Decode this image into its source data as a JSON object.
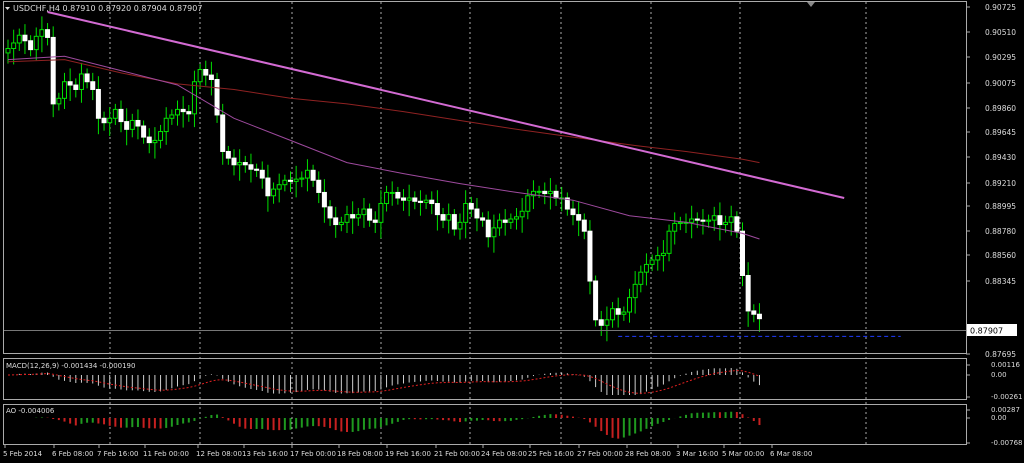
{
  "chart_data": [
    {
      "type": "candlestick",
      "symbol_line": "USDCHF,H4  0.87910 0.87920 0.87904 0.87907",
      "ylim": [
        0.876,
        0.9077
      ],
      "y_ticks": [
        "0.90725",
        "0.90510",
        "0.90295",
        "0.90075",
        "0.89860",
        "0.89645",
        "0.89430",
        "0.89210",
        "0.88995",
        "0.88780",
        "0.88560",
        "0.88345",
        "0.87907",
        "0.87695"
      ],
      "last_price_label": "0.87907",
      "x_ticks": [
        "5 Feb 2014",
        "6 Feb 08:00",
        "7 Feb 16:00",
        "11 Feb 00:00",
        "12 Feb 08:00",
        "13 Feb 16:00",
        "17 Feb 00:00",
        "18 Feb 08:00",
        "19 Feb 16:00",
        "21 Feb 00:00",
        "24 Feb 08:00",
        "25 Feb 16:00",
        "27 Feb 00:00",
        "28 Feb 08:00",
        "3 Mar 16:00",
        "5 Mar 00:00",
        "6 Mar 08:00"
      ],
      "close": [
        0.9035,
        0.904,
        0.9047,
        0.9042,
        0.9034,
        0.9046,
        0.9052,
        0.9045,
        0.8985,
        0.899,
        0.9005,
        0.9002,
        0.8998,
        0.9012,
        0.9005,
        0.8998,
        0.8972,
        0.8968,
        0.8972,
        0.898,
        0.8969,
        0.8962,
        0.897,
        0.8965,
        0.8955,
        0.895,
        0.8952,
        0.896,
        0.8972,
        0.8975,
        0.898,
        0.8978,
        0.8976,
        0.9005,
        0.9016,
        0.9011,
        0.9007,
        0.8975,
        0.8942,
        0.8936,
        0.893,
        0.8932,
        0.893,
        0.8926,
        0.8925,
        0.8918,
        0.8902,
        0.8908,
        0.8912,
        0.8916,
        0.8915,
        0.8917,
        0.8918,
        0.8925,
        0.8916,
        0.8905,
        0.8892,
        0.8882,
        0.8876,
        0.8878,
        0.8885,
        0.8882,
        0.8885,
        0.889,
        0.888,
        0.8878,
        0.8895,
        0.8905,
        0.8905,
        0.89,
        0.8898,
        0.89,
        0.8897,
        0.8896,
        0.8898,
        0.8895,
        0.8885,
        0.888,
        0.8885,
        0.8872,
        0.8878,
        0.8895,
        0.889,
        0.8882,
        0.888,
        0.8865,
        0.8873,
        0.888,
        0.8878,
        0.8881,
        0.8883,
        0.8888,
        0.8902,
        0.8906,
        0.8906,
        0.8904,
        0.8906,
        0.89,
        0.89,
        0.889,
        0.8885,
        0.888,
        0.887,
        0.8825,
        0.879,
        0.8785,
        0.879,
        0.88,
        0.8795,
        0.8797,
        0.881,
        0.8822,
        0.8833,
        0.884,
        0.8844,
        0.8848,
        0.885,
        0.887,
        0.8877,
        0.8878,
        0.8878,
        0.8881,
        0.888,
        0.8879,
        0.888,
        0.8884,
        0.8876,
        0.8878,
        0.8883,
        0.887,
        0.883,
        0.8798,
        0.8795,
        0.8791
      ],
      "series": [
        {
          "name": "",
          "kind": "ma",
          "color": "#8f2222",
          "points": [
            [
              0,
              0.9023
            ],
            [
              10,
              0.9025
            ],
            [
              20,
              0.9013
            ],
            [
              30,
              0.9003
            ],
            [
              40,
              0.8998
            ],
            [
              50,
              0.899
            ],
            [
              60,
              0.8985
            ],
            [
              70,
              0.8978
            ],
            [
              80,
              0.897
            ],
            [
              90,
              0.8962
            ],
            [
              100,
              0.8955
            ],
            [
              110,
              0.8948
            ],
            [
              120,
              0.8942
            ],
            [
              130,
              0.8935
            ],
            [
              133,
              0.8932
            ]
          ]
        },
        {
          "name": "",
          "kind": "ma",
          "color": "#9e4a9e",
          "points": [
            [
              0,
              0.9025
            ],
            [
              10,
              0.9028
            ],
            [
              20,
              0.9015
            ],
            [
              30,
              0.9002
            ],
            [
              40,
              0.8972
            ],
            [
              50,
              0.8952
            ],
            [
              60,
              0.8932
            ],
            [
              70,
              0.8922
            ],
            [
              80,
              0.8913
            ],
            [
              90,
              0.8905
            ],
            [
              100,
              0.8898
            ],
            [
              110,
              0.8884
            ],
            [
              120,
              0.8878
            ],
            [
              130,
              0.8868
            ],
            [
              133,
              0.8863
            ]
          ]
        },
        {
          "name": "",
          "kind": "trendline",
          "color": "#d36bd3",
          "points": [
            [
              7,
              0.9068
            ],
            [
              148,
              0.89
            ]
          ]
        },
        {
          "name": "",
          "kind": "level",
          "color": "#1f3cff",
          "points": [
            [
              108,
              0.8775
            ],
            [
              158,
              0.8775
            ]
          ]
        }
      ]
    },
    {
      "type": "bar",
      "label_line": "MACD(12,26,9) -0.001434 -0.000190",
      "y_ticks": [
        "0.00116",
        "0.00",
        "-0.00261"
      ],
      "ylim": [
        -0.003,
        0.0015
      ]
    },
    {
      "type": "bar",
      "label_line": "AO -0.004006",
      "y_ticks": [
        "0.00287",
        "0.00",
        "-0.00768"
      ],
      "ylim": [
        -0.0085,
        0.0035
      ]
    }
  ]
}
